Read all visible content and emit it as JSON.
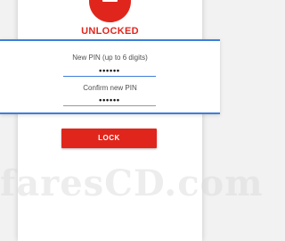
{
  "app": {
    "status": "UNLOCKED",
    "accent_color": "#e0261c",
    "focus_color": "#3f7fd8",
    "lock_icon": "lock-icon"
  },
  "pin_panel": {
    "new_pin_label": "New PIN (up to 6 digits)",
    "new_pin_value": "••••••",
    "confirm_label": "Confirm new PIN",
    "confirm_value": "••••••"
  },
  "actions": {
    "lock_label": "LOCK"
  },
  "watermark": {
    "text": "faresCD.com"
  }
}
